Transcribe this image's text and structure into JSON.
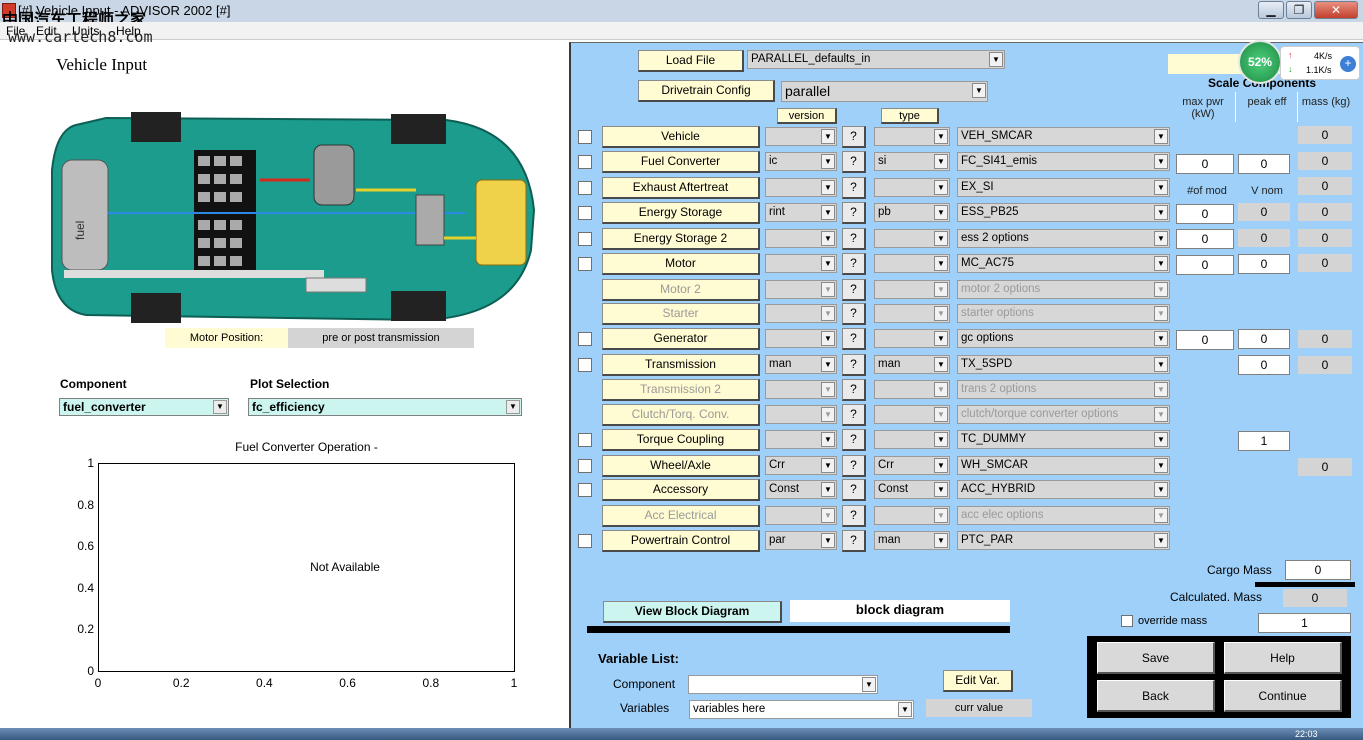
{
  "window": {
    "title": "[#] Vehicle Input - ADVISOR 2002  [#]",
    "watermark": "中国汽车工程师之家",
    "watermark_url": "www.cartech8.com"
  },
  "menu": [
    "File",
    "Edit",
    "Units",
    "Help"
  ],
  "left": {
    "title": "Vehicle Input",
    "car_labels": {
      "fuel": "fuel"
    },
    "motor_position_label": "Motor Position:",
    "motor_position_value": "pre or post transmission",
    "component_label": "Component",
    "component_value": "fuel_converter",
    "plot_label": "Plot Selection",
    "plot_value": "fc_efficiency",
    "plot_title": "Fuel Converter Operation -",
    "plot_placeholder": "Not Available",
    "yticks": [
      "1",
      "0.8",
      "0.6",
      "0.4",
      "0.2",
      "0"
    ],
    "xticks": [
      "0",
      "0.2",
      "0.4",
      "0.6",
      "0.8",
      "1"
    ]
  },
  "right": {
    "load_file_btn": "Load File",
    "load_file_value": "PARALLEL_defaults_in",
    "drivetrain_btn": "Drivetrain Config",
    "drivetrain_value": "parallel",
    "version_hdr": "version",
    "type_hdr": "type",
    "scale_hdr": "Scale Components",
    "col_maxpwr": "max pwr (kW)",
    "col_peakeff": "peak eff",
    "col_mass": "mass (kg)",
    "col_numod": "#of mod",
    "col_vnom": "V nom",
    "rows": [
      {
        "label": "Vehicle",
        "version": "",
        "type": "",
        "file": "VEH_SMCAR",
        "dis": false,
        "chk": true
      },
      {
        "label": "Fuel Converter",
        "version": "ic",
        "type": "si",
        "file": "FC_SI41_emis",
        "dis": false,
        "chk": true
      },
      {
        "label": "Exhaust Aftertreat",
        "version": "",
        "type": "",
        "file": "EX_SI",
        "dis": false,
        "chk": true
      },
      {
        "label": "Energy Storage",
        "version": "rint",
        "type": "pb",
        "file": "ESS_PB25",
        "dis": false,
        "chk": true
      },
      {
        "label": "Energy Storage 2",
        "version": "",
        "type": "",
        "file": "ess 2 options",
        "dis": false,
        "chk": true
      },
      {
        "label": "Motor",
        "version": "",
        "type": "",
        "file": "MC_AC75",
        "dis": false,
        "chk": true
      },
      {
        "label": "Motor 2",
        "version": "",
        "type": "",
        "file": "motor 2 options",
        "dis": true,
        "chk": false
      },
      {
        "label": "Starter",
        "version": "",
        "type": "",
        "file": "starter options",
        "dis": true,
        "chk": false
      },
      {
        "label": "Generator",
        "version": "",
        "type": "",
        "file": "gc options",
        "dis": false,
        "chk": true
      },
      {
        "label": "Transmission",
        "version": "man",
        "type": "man",
        "file": "TX_5SPD",
        "dis": false,
        "chk": true
      },
      {
        "label": "Transmission 2",
        "version": "",
        "type": "",
        "file": "trans 2 options",
        "dis": true,
        "chk": false
      },
      {
        "label": "Clutch/Torq. Conv.",
        "version": "",
        "type": "",
        "file": "clutch/torque converter options",
        "dis": true,
        "chk": false
      },
      {
        "label": "Torque Coupling",
        "version": "",
        "type": "",
        "file": "TC_DUMMY",
        "dis": false,
        "chk": true
      },
      {
        "label": "Wheel/Axle",
        "version": "Crr",
        "type": "Crr",
        "file": "WH_SMCAR",
        "dis": false,
        "chk": true
      },
      {
        "label": "Accessory",
        "version": "Const",
        "type": "Const",
        "file": "ACC_HYBRID",
        "dis": false,
        "chk": true
      },
      {
        "label": "Acc Electrical",
        "version": "",
        "type": "",
        "file": "acc elec options",
        "dis": true,
        "chk": false
      },
      {
        "label": "Powertrain Control",
        "version": "par",
        "type": "man",
        "file": "PTC_PAR",
        "dis": false,
        "chk": true
      }
    ],
    "scale": {
      "fc_maxpwr": "0",
      "fc_peakeff": "0",
      "veh_mass": "0",
      "fc_mass": "0",
      "ex_mass": "0",
      "es_numod": "0",
      "es_vnom": "0",
      "es_mass": "0",
      "es2_numod": "0",
      "es2_vnom": "0",
      "es2_mass": "0",
      "mc_maxpwr": "0",
      "mc_peakeff": "0",
      "mc_mass": "0",
      "gc_maxpwr": "0",
      "gc_peakeff": "0",
      "gc_mass": "0",
      "tx_peakeff": "0",
      "tx_mass": "0",
      "tc_peakeff": "1",
      "wh_mass": "0"
    },
    "cargo_label": "Cargo Mass",
    "cargo_value": "0",
    "calc_label": "Calculated. Mass",
    "calc_value": "0",
    "override_label": "override mass",
    "override_value": "1",
    "view_block_btn": "View Block Diagram",
    "block_diagram": "block diagram",
    "var_list": "Variable List:",
    "var_component": "Component",
    "var_variables": "Variables",
    "var_variables_value": "variables here",
    "edit_var": "Edit Var.",
    "curr_value": "curr value",
    "save": "Save",
    "help": "Help",
    "back": "Back",
    "continue": "Continue"
  },
  "overlay": {
    "percent": "52%",
    "up": "4K/s",
    "down": "1.1K/s"
  },
  "taskbar": {
    "clock": "22:03"
  }
}
